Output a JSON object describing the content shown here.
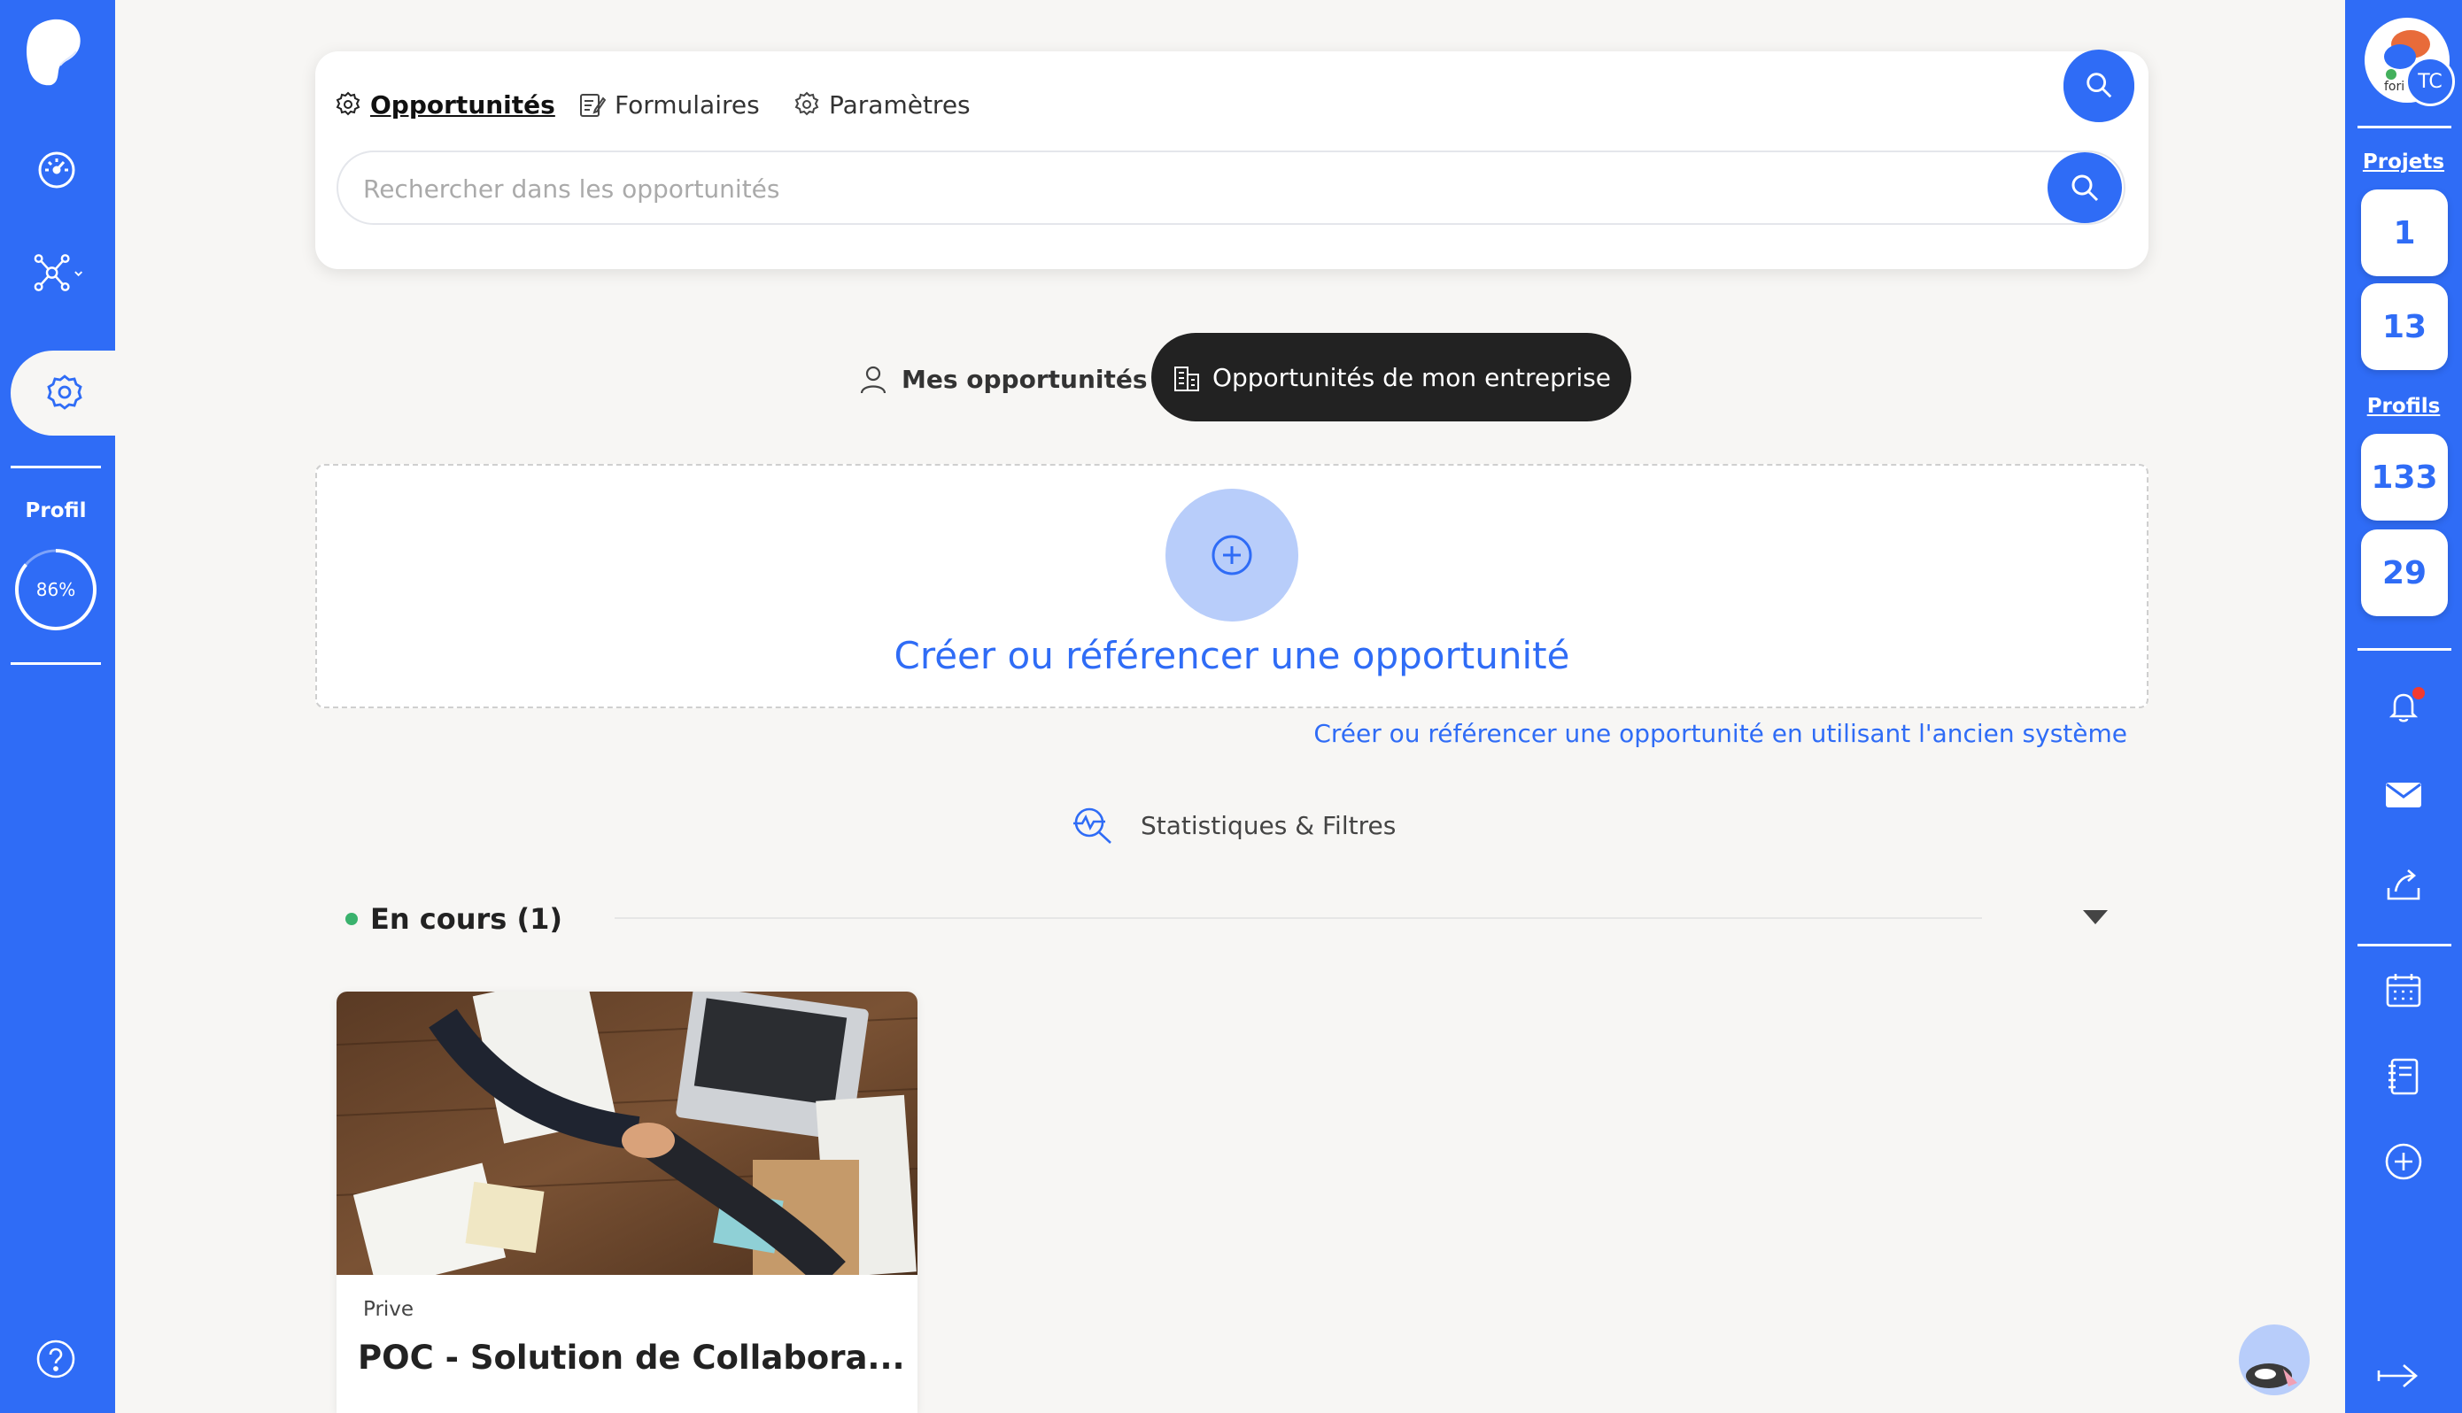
{
  "left_sidebar": {
    "icons": [
      "logo-icon",
      "dashboard-icon",
      "network-icon",
      "award-icon",
      "help-icon"
    ],
    "profil_label": "Profil",
    "profil_completion": "86%",
    "profil_completion_fraction": 0.86
  },
  "search_card": {
    "tabs": [
      {
        "label": "Opportunités",
        "icon": "gear-icon",
        "active": true
      },
      {
        "label": "Formulaires",
        "icon": "form-icon",
        "active": false
      },
      {
        "label": "Paramètres",
        "icon": "gear-icon",
        "active": false
      }
    ],
    "search_placeholder": "Rechercher dans les opportunités"
  },
  "toggle": {
    "mine_label": "Mes opportunités",
    "company_label": "Opportunités de mon entreprise",
    "active": "company"
  },
  "create": {
    "label": "Créer ou référencer une opportunité",
    "legacy_link": "Créer ou référencer une opportunité en utilisant l'ancien système"
  },
  "stats_label": "Statistiques & Filtres",
  "section": {
    "label": "En cours (1)",
    "status_color": "#3ab26d"
  },
  "cards": [
    {
      "privacy": "Prive",
      "title": "POC - Solution de Collabora..."
    }
  ],
  "right_sidebar": {
    "avatar_initials": "TC",
    "avatar_caption": "fori",
    "projets_label": "Projets",
    "projets_counts": [
      "1",
      "13"
    ],
    "profils_label": "Profils",
    "profils_counts": [
      "133",
      "29"
    ],
    "icons": [
      "bell-icon",
      "mail-icon",
      "share-icon",
      "calendar-icon",
      "notebook-icon",
      "add-icon",
      "logout-icon"
    ]
  },
  "colors": {
    "brand": "#2f6cf6",
    "dark": "#222222",
    "background": "#f7f6f4",
    "accent_light": "#b8cdfa"
  }
}
